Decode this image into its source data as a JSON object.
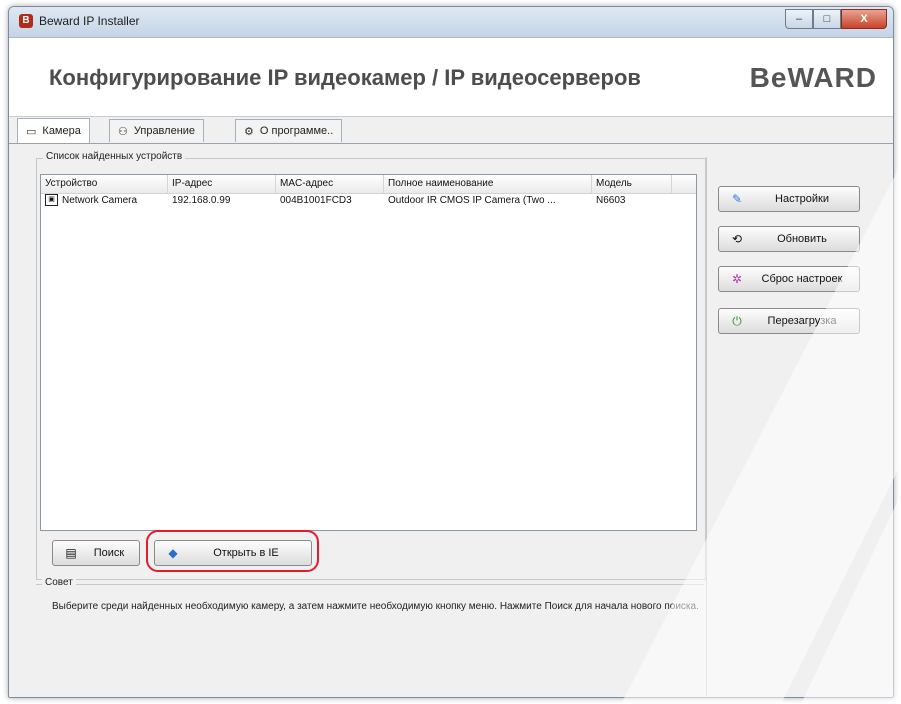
{
  "window": {
    "title": "Beward IP Installer",
    "controls": {
      "minimize": "–",
      "maximize": "□",
      "close": "X"
    }
  },
  "header": {
    "title": "Конфигурирование IP видеокамер / IP видеосерверов",
    "brand": "BeWARD"
  },
  "tabs": [
    {
      "label": "Камера",
      "icon": "camera-icon",
      "active": true
    },
    {
      "label": "Управление",
      "icon": "users-icon",
      "active": false
    },
    {
      "label": "О программе..",
      "icon": "info-icon",
      "active": false
    }
  ],
  "devices_group": {
    "label": "Список найденных устройств",
    "columns": [
      "Устройство",
      "IP-адрес",
      "MAC-адрес",
      "Полное наименование",
      "Модель"
    ],
    "rows": [
      {
        "device": "Network Camera",
        "ip": "192.168.0.99",
        "mac": "004B1001FCD3",
        "full_name": "Outdoor IR CMOS IP Camera (Two ...",
        "model": "N6603"
      }
    ]
  },
  "bottom_buttons": {
    "search": "Поиск",
    "open_ie": "Открыть в IE"
  },
  "side_buttons": {
    "settings": "Настройки",
    "refresh": "Обновить",
    "reset": "Сброс настроек",
    "reboot": "Перезагрузка"
  },
  "advice": {
    "label": "Совет",
    "text": "Выберите среди найденных необходимую камеру, а затем нажмите необходимую кнопку меню. Нажмите Поиск для начала нового поиска."
  },
  "colors": {
    "highlight": "#e21c2a",
    "brand_text": "#555555"
  }
}
